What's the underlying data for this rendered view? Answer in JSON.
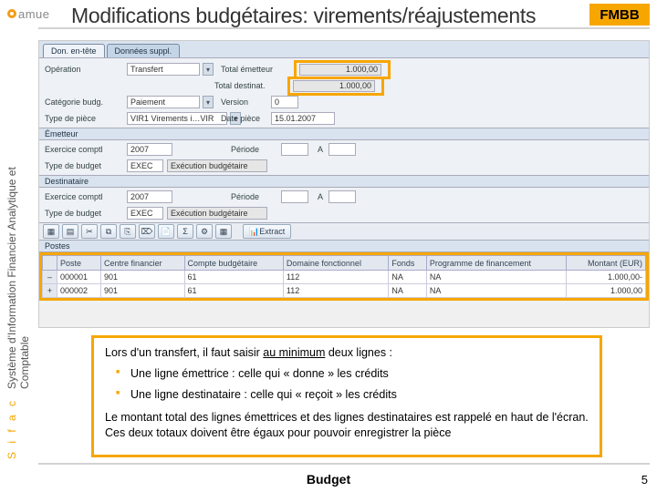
{
  "logo": {
    "text": "amue"
  },
  "title": "Modifications budgétaires: virements/réajustements",
  "tcode": "FMBB",
  "vertical": {
    "brand": "S i f a c",
    "line1": "Système d'Information Financier Analytique et",
    "line2": "Comptable"
  },
  "sap": {
    "tabs": {
      "t1": "Don. en-tête",
      "t2": "Données suppl."
    },
    "r1": {
      "label": "Opération",
      "value": "Transfert",
      "total_e_label": "Total émetteur",
      "total_e": "1.000,00",
      "total_d_label": "Total destinat.",
      "total_d": "1.000,00"
    },
    "r2": {
      "label": "Catégorie budg.",
      "value": "Paiement",
      "ver_label": "Version",
      "ver": "0"
    },
    "r3": {
      "label": "Type de pièce",
      "value": "VIR1 Virements i…VIR",
      "date_label": "Date pièce",
      "date": "15.01.2007"
    },
    "sec_emetteur": "Émetteur",
    "r4": {
      "label": "Exercice comptl",
      "value": "2007",
      "per_label": "Période",
      "per": "",
      "a_label": "A",
      "a": ""
    },
    "r5": {
      "label": "Type de budget",
      "value": "EXEC",
      "value2": "Exécution budgétaire"
    },
    "sec_dest": "Destinataire",
    "r6": {
      "label": "Exercice comptl",
      "value": "2007",
      "per_label": "Période",
      "per": "",
      "a_label": "A",
      "a": ""
    },
    "r7": {
      "label": "Type de budget",
      "value": "EXEC",
      "value2": "Exécution budgétaire"
    },
    "toolbar": {
      "extract": "Extract"
    },
    "grid_title": "Postes",
    "grid": {
      "headers": {
        "c0": "",
        "c1": "Poste",
        "c2": "Centre financier",
        "c3": "Compte budgétaire",
        "c4": "Domaine fonctionnel",
        "c5": "Fonds",
        "c6": "Programme de financement",
        "c7": "Montant (EUR)"
      },
      "rows": [
        {
          "sel": "–",
          "poste": "000001",
          "cf": "901",
          "cb": "61",
          "df": "112",
          "fonds": "NA",
          "prog": "NA",
          "montant": "1.000,00-"
        },
        {
          "sel": "+",
          "poste": "000002",
          "cf": "901",
          "cb": "61",
          "df": "112",
          "fonds": "NA",
          "prog": "NA",
          "montant": "1.000,00"
        }
      ]
    }
  },
  "note": {
    "intro_a": "Lors d'un transfert, il faut saisir ",
    "intro_u": "au minimum",
    "intro_b": " deux lignes :",
    "li1": "Une ligne émettrice : celle qui « donne » les crédits",
    "li2": "Une ligne destinataire : celle qui  « reçoit » les crédits",
    "para": "Le montant total des lignes émettrices et des lignes destinataires est rappelé en haut de l'écran. Ces deux totaux doivent être égaux pour pouvoir enregistrer la pièce"
  },
  "footer": {
    "title": "Budget",
    "page": "5"
  }
}
